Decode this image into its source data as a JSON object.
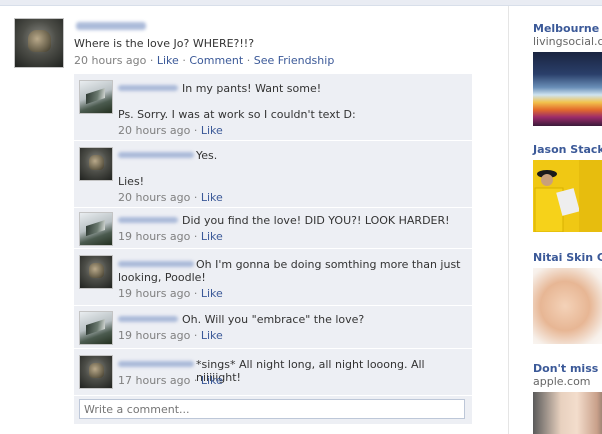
{
  "post": {
    "author": "Garrus Vakarian",
    "text": "Where is the love Jo? WHERE?!!?",
    "time": "20 hours ago",
    "actions": [
      "Like",
      "Comment",
      "See Friendship"
    ],
    "separator": "·"
  },
  "comments": [
    {
      "author": "Jo Hollorowe",
      "avatar": "jo",
      "lines": [
        "In my pants! Want some!",
        "",
        "Ps. Sorry. I was at work so I couldn't text D:"
      ],
      "time": "20 hours ago",
      "like": "Like"
    },
    {
      "author": "Garrus Vakarian",
      "avatar": "garrus",
      "lines": [
        "Yes.",
        "",
        "Lies!"
      ],
      "time": "20 hours ago",
      "like": "Like"
    },
    {
      "author": "Jo Hollorowe",
      "avatar": "jo",
      "lines": [
        "Did you find the love! DID YOU?! LOOK HARDER!"
      ],
      "time": "19 hours ago",
      "like": "Like"
    },
    {
      "author": "Garrus Vakarian",
      "avatar": "garrus",
      "lines": [
        "Oh I'm gonna be doing somthing more than just",
        "looking, Poodle!"
      ],
      "time": "19 hours ago",
      "like": "Like"
    },
    {
      "author": "Jo Hollorowe",
      "avatar": "jo",
      "lines": [
        "Oh. Will you \"embrace\" the love?"
      ],
      "time": "19 hours ago",
      "like": "Like"
    },
    {
      "author": "Garrus Vakarian",
      "avatar": "garrus",
      "lines": [
        "*sings* All night long, all night looong. All niiiiight!"
      ],
      "time": "17 hours ago",
      "like": "Like"
    }
  ],
  "comment_box": {
    "placeholder": "Write a comment..."
  },
  "sidebar": {
    "ads": [
      {
        "title": "Melbourne B",
        "subtitle": "livingsocial.com"
      },
      {
        "title": "Jason Stack",
        "subtitle": ""
      },
      {
        "title": "Nitai Skin Cli",
        "subtitle": ""
      },
      {
        "title": "Don't miss H",
        "subtitle": "apple.com"
      }
    ]
  },
  "colors": {
    "link": "#3b5998",
    "comment_bg": "#edeff4",
    "meta": "#808080"
  }
}
